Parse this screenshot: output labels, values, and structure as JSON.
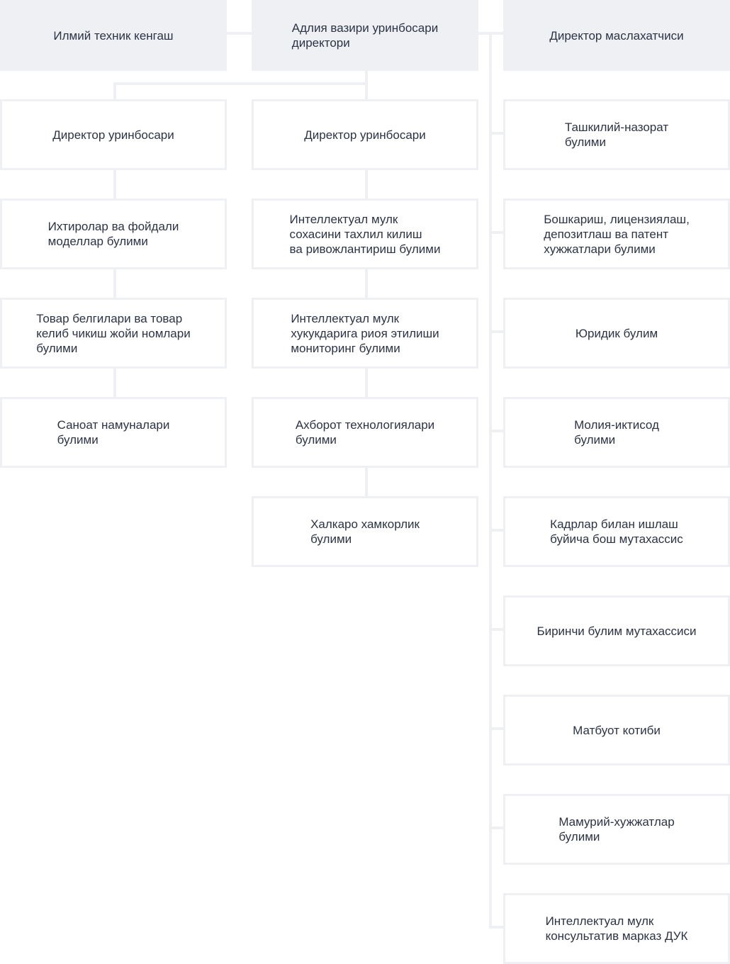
{
  "top": {
    "left": "Илмий техник кенгаш",
    "center": "Адлия вазири уринбосари\nдиректори",
    "right": "Директор маслахатчиси"
  },
  "col1": [
    "Директор уринбосари",
    "Ихтиролар ва фойдали\nмоделлар булими",
    "Товар белгилари ва товар\nкелиб чикиш жойи номлари\nбулими",
    "Саноат намуналари\nбулими"
  ],
  "col2": [
    "Директор уринбосари",
    "Интеллектуал мулк\nсохасини тахлил килиш\nва ривожлантириш булими",
    "Интеллектуал мулк\nхукукдарига риоя этилиши\nмониторинг булими",
    "Ахборот технологиялари\nбулими",
    "Халкаро хамкорлик\nбулими"
  ],
  "col3": [
    "Ташкилий-назорат\nбулими",
    "Бошкариш, лицензиялаш,\nдепозитлаш ва патент\nхужжатлари булими",
    "Юридик булим",
    "Молия-иктисод\nбулими",
    "Кадрлар билан ишлаш\nбуйича бош мутахассис",
    "Биринчи булим мутахассиси",
    "Матбуот котиби",
    "Мамурий-хужжатлар\nбулими",
    "Интеллектуал мулк\nконсультатив марказ ДУК"
  ]
}
